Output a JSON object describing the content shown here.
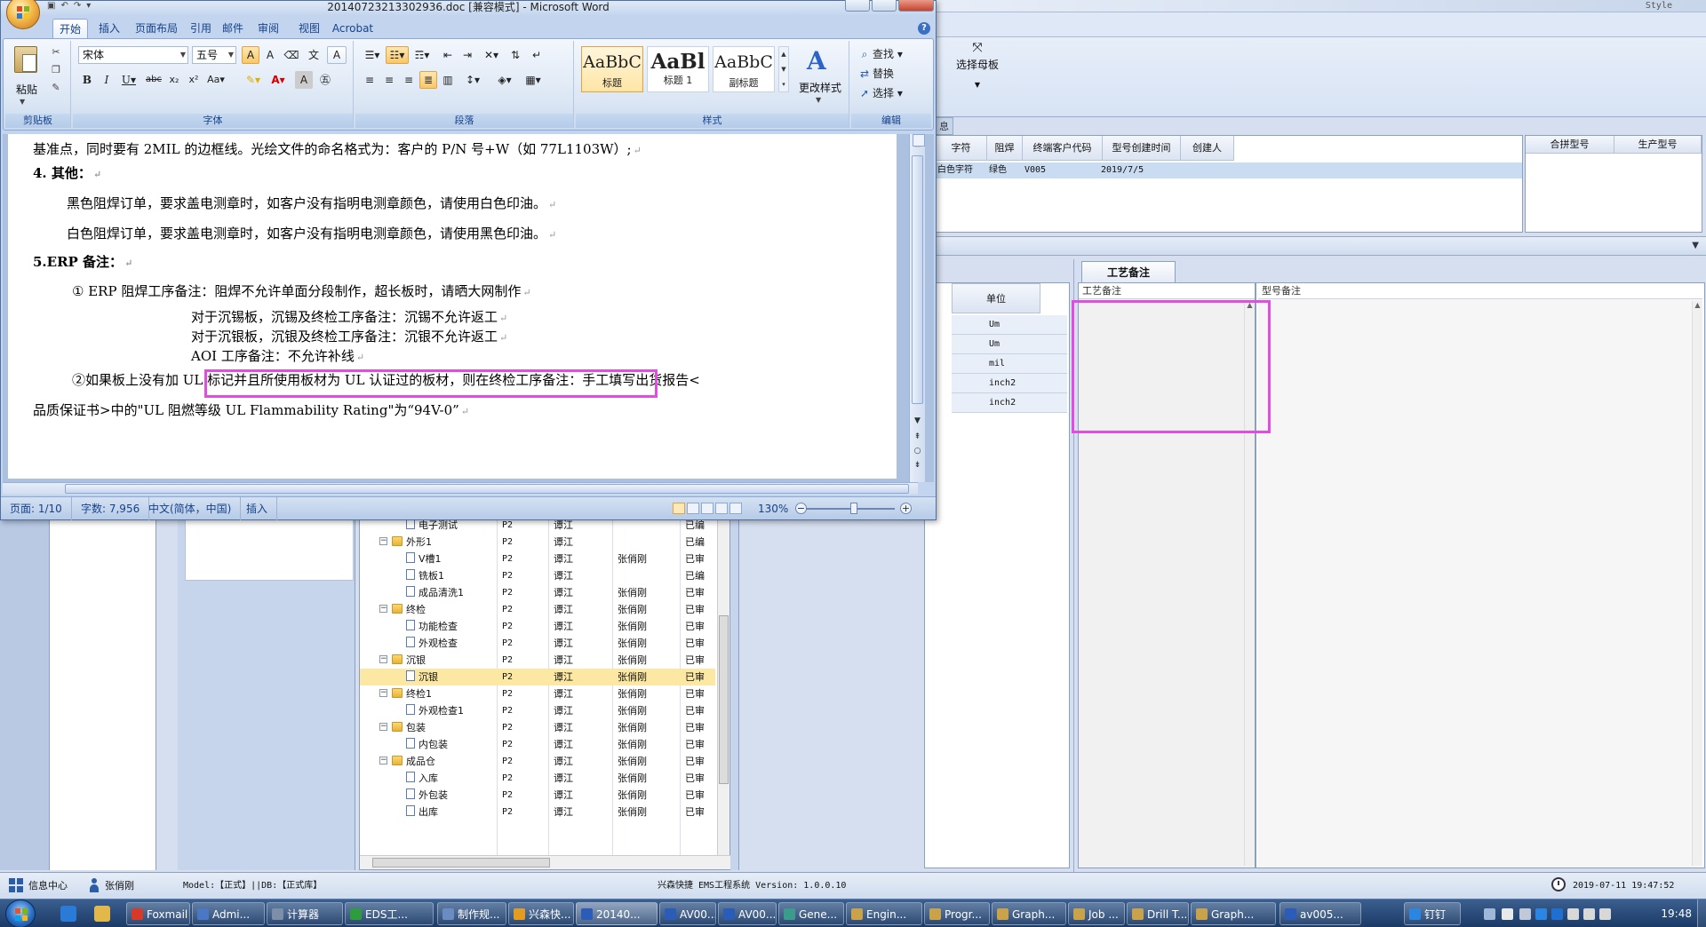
{
  "erp": {
    "style_text": "Style",
    "template_btn_label": "选择母板",
    "info_tab_label": "息",
    "top_grid_headers": [
      "字符",
      "阻焊",
      "终端客户代码",
      "型号创建时间",
      "创建人"
    ],
    "top_grid_row": [
      "白色字符",
      "绿色",
      "V005",
      "2019/7/5",
      ""
    ],
    "side_grid_headers": [
      "合拼型号",
      "生产型号"
    ],
    "unit_header": "单位",
    "unit_values": [
      "Um",
      "Um",
      "mil",
      "inch2",
      "inch2"
    ],
    "remark_tab": "工艺备注",
    "remark_col1": "工艺备注",
    "remark_col2": "型号备注",
    "tree_rows": [
      {
        "level": 2,
        "type": "doc",
        "name": "电子测试",
        "c1": "P2",
        "c2": "谭江",
        "c3": "",
        "c4": "已编",
        "sel": false
      },
      {
        "level": 1,
        "type": "folder",
        "name": "外形1",
        "c1": "P2",
        "c2": "谭江",
        "c3": "",
        "c4": "已编",
        "sel": false
      },
      {
        "level": 2,
        "type": "doc",
        "name": "V槽1",
        "c1": "P2",
        "c2": "谭江",
        "c3": "张俏刚",
        "c4": "已审",
        "sel": false
      },
      {
        "level": 2,
        "type": "doc",
        "name": "铣板1",
        "c1": "P2",
        "c2": "谭江",
        "c3": "",
        "c4": "已编",
        "sel": false
      },
      {
        "level": 2,
        "type": "doc",
        "name": "成品清洗1",
        "c1": "P2",
        "c2": "谭江",
        "c3": "张俏刚",
        "c4": "已审",
        "sel": false
      },
      {
        "level": 1,
        "type": "folder",
        "name": "终检",
        "c1": "P2",
        "c2": "谭江",
        "c3": "张俏刚",
        "c4": "已审",
        "sel": false
      },
      {
        "level": 2,
        "type": "doc",
        "name": "功能检查",
        "c1": "P2",
        "c2": "谭江",
        "c3": "张俏刚",
        "c4": "已审",
        "sel": false
      },
      {
        "level": 2,
        "type": "doc",
        "name": "外观检查",
        "c1": "P2",
        "c2": "谭江",
        "c3": "张俏刚",
        "c4": "已审",
        "sel": false
      },
      {
        "level": 1,
        "type": "folder",
        "name": "沉银",
        "c1": "P2",
        "c2": "谭江",
        "c3": "张俏刚",
        "c4": "已审",
        "sel": false
      },
      {
        "level": 2,
        "type": "doc",
        "name": "沉银",
        "c1": "P2",
        "c2": "谭江",
        "c3": "张俏刚",
        "c4": "已审",
        "sel": true
      },
      {
        "level": 1,
        "type": "folder",
        "name": "终检1",
        "c1": "P2",
        "c2": "谭江",
        "c3": "张俏刚",
        "c4": "已审",
        "sel": false
      },
      {
        "level": 2,
        "type": "doc",
        "name": "外观检查1",
        "c1": "P2",
        "c2": "谭江",
        "c3": "张俏刚",
        "c4": "已审",
        "sel": false
      },
      {
        "level": 1,
        "type": "folder",
        "name": "包装",
        "c1": "P2",
        "c2": "谭江",
        "c3": "张俏刚",
        "c4": "已审",
        "sel": false
      },
      {
        "level": 2,
        "type": "doc",
        "name": "内包装",
        "c1": "P2",
        "c2": "谭江",
        "c3": "张俏刚",
        "c4": "已审",
        "sel": false
      },
      {
        "level": 1,
        "type": "folder",
        "name": "成品仓",
        "c1": "P2",
        "c2": "谭江",
        "c3": "张俏刚",
        "c4": "已审",
        "sel": false
      },
      {
        "level": 2,
        "type": "doc",
        "name": "入库",
        "c1": "P2",
        "c2": "谭江",
        "c3": "张俏刚",
        "c4": "已审",
        "sel": false
      },
      {
        "level": 2,
        "type": "doc",
        "name": "外包装",
        "c1": "P2",
        "c2": "谭江",
        "c3": "张俏刚",
        "c4": "已审",
        "sel": false
      },
      {
        "level": 2,
        "type": "doc",
        "name": "出库",
        "c1": "P2",
        "c2": "谭江",
        "c3": "张俏刚",
        "c4": "已审",
        "sel": false
      }
    ],
    "status": {
      "info_center": "信息中心",
      "user": "张俏刚",
      "model_db": "Model:【正式】||DB:【正式库】",
      "app_name": "兴森快捷 EMS工程系统 Version: 1.0.0.10",
      "datetime": "2019-07-11 19:47:52"
    }
  },
  "word": {
    "title": "20140723213302936.doc [兼容模式] - Microsoft Word",
    "tabs": [
      "开始",
      "插入",
      "页面布局",
      "引用",
      "邮件",
      "审阅",
      "视图",
      "Acrobat"
    ],
    "active_tab": "开始",
    "ribbon": {
      "paste": "粘贴",
      "font_name": "宋体",
      "font_size": "五号",
      "styles": [
        {
          "sample": "AaBbC",
          "name": "标题"
        },
        {
          "sample": "AaBl",
          "name": "标题 1"
        },
        {
          "sample": "AaBbC",
          "name": "副标题"
        }
      ],
      "change_styles": "更改样式",
      "find": "查找",
      "replace": "替换",
      "select": "选择",
      "groups": [
        "剪贴板",
        "字体",
        "段落",
        "样式",
        "编辑"
      ]
    },
    "doc_lines": [
      {
        "text": "基准点，同时要有 2MIL 的边框线。光绘文件的命名格式为：客户的  P/N 号+W（如 77L1103W）;",
        "bold": false
      },
      {
        "text": "4. 其他：",
        "bold": true
      },
      {
        "text": "黑色阻焊订单，要求盖电测章时，如客户没有指明电测章颜色，请使用白色印油。",
        "bold": false
      },
      {
        "text": "白色阻焊订单，要求盖电测章时，如客户没有指明电测章颜色，请使用黑色印油。",
        "bold": false
      },
      {
        "text": "5.ERP 备注：",
        "bold": true
      },
      {
        "text": "① ERP 阻焊工序备注：阻焊不允许单面分段制作，超长板时，请晒大网制作",
        "bold": false
      },
      {
        "text": "对于沉锡板，沉锡及终检工序备注：沉锡不允许返工",
        "bold": false
      },
      {
        "text": "对于沉银板，沉银及终检工序备注：沉银不允许返工",
        "bold": false
      },
      {
        "text": "AOI 工序备注：不允许补线",
        "bold": false
      },
      {
        "text": "②如果板上没有加 UL 标记并且所使用板材为 UL 认证过的板材，则在终检工序备注：手工填写出货报告<",
        "bold": false
      },
      {
        "text": "品质保证书>中的\"UL 阻燃等级 UL Flammability Rating\"为“94V-0”",
        "bold": false
      }
    ],
    "para_mark": "↵",
    "status": {
      "page": "页面: 1/10",
      "words": "字数: 7,956",
      "lang": "中文(简体，中国)",
      "mode": "插入",
      "zoom": "130%"
    }
  },
  "taskbar": {
    "buttons": [
      {
        "label": "Foxmail",
        "color": "#d83a2a"
      },
      {
        "label": "Admi...",
        "color": "#4a78c4"
      },
      {
        "label": "计算器",
        "color": "#7d8fa8"
      },
      {
        "label": "EDS工...",
        "color": "#2e9b3c"
      },
      {
        "label": "制作规...",
        "color": "#6a8cc2"
      },
      {
        "label": "兴森快...",
        "color": "#e39b20"
      },
      {
        "label": "20140...",
        "color": "#2b5cb8"
      },
      {
        "label": "AV00...",
        "color": "#2b5cb8"
      },
      {
        "label": "AV00...",
        "color": "#2b5cb8"
      },
      {
        "label": "Gene...",
        "color": "#3c9c8c"
      },
      {
        "label": "Engin...",
        "color": "#c9a24a"
      },
      {
        "label": "Progr...",
        "color": "#c9a24a"
      },
      {
        "label": "Graph...",
        "color": "#c9a24a"
      },
      {
        "label": "Job ...",
        "color": "#c9a24a"
      },
      {
        "label": "Drill T...",
        "color": "#c9a24a"
      },
      {
        "label": "Graph...",
        "color": "#c9a24a"
      },
      {
        "label": "av005...",
        "color": "#2b5cb8"
      },
      {
        "label": "钉钉",
        "color": "#2a86e0"
      }
    ],
    "active_index": 6,
    "clock": "19:48"
  }
}
